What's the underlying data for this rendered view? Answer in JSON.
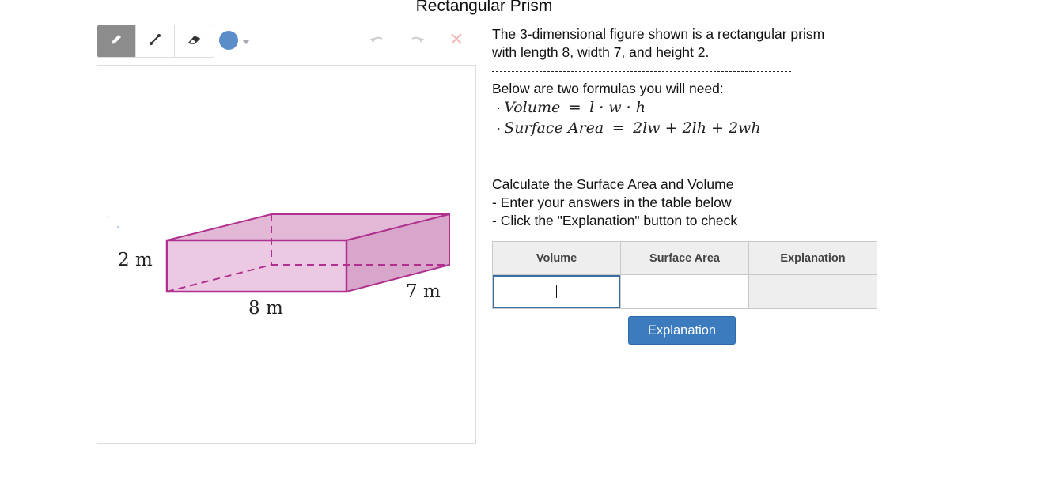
{
  "title": "Rectangular Prism",
  "toolbar": {
    "tools": [
      "pencil-icon",
      "line-icon",
      "eraser-icon"
    ],
    "active_tool": "pencil-icon",
    "pen_color": "#5b8dc9"
  },
  "figure": {
    "height_label": "2 m",
    "length_label": "8 m",
    "width_label": "7 m"
  },
  "intro": {
    "line1": "The 3-dimensional figure shown is a rectangular prism",
    "line2": "with length 8, width 7, and height 2."
  },
  "formulas": {
    "header": "Below are two formulas you will need:",
    "volume_name": "Volume",
    "volume_expr": "l · w · h",
    "sa_name": "Surface Area",
    "sa_expr": "2lw + 2lh + 2wh"
  },
  "instructions": {
    "line1": "Calculate the Surface Area and Volume",
    "line2": "- Enter your answers in the table below",
    "line3": "- Click the \"Explanation\" button to check"
  },
  "table": {
    "headers": [
      "Volume",
      "Surface Area",
      "Explanation"
    ],
    "values": [
      "",
      "",
      ""
    ]
  },
  "button": {
    "label": "Explanation"
  },
  "colors": {
    "accent": "#3d7bbf",
    "prism_stroke": "#b0308f",
    "prism_fill": "#e6c3dd"
  }
}
